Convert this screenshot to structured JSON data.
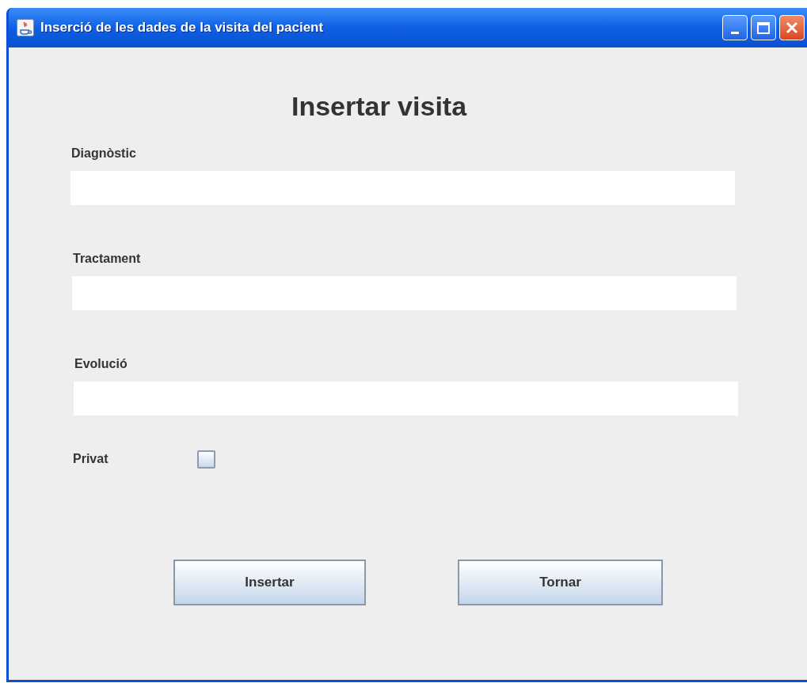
{
  "window": {
    "title": "Inserció de les dades de la visita del pacient"
  },
  "heading": "Insertar visita",
  "fields": [
    {
      "label": "Diagnòstic"
    },
    {
      "label": "Tractament"
    },
    {
      "label": "Evolució"
    }
  ],
  "private_option": {
    "label": "Privat",
    "checked": false
  },
  "buttons": [
    "Insertar",
    "Tornar"
  ]
}
